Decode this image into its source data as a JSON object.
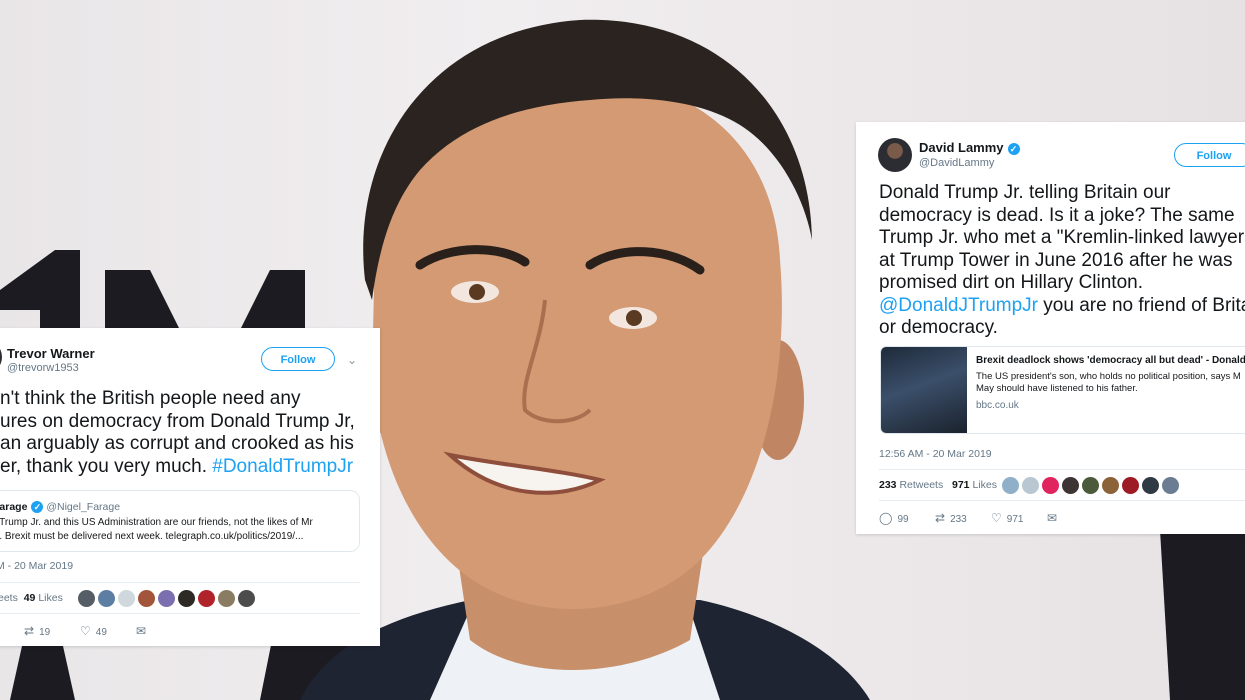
{
  "colors": {
    "accent": "#1da1f2",
    "text_primary": "#14171a",
    "text_secondary": "#657786",
    "heart": "#e0245e"
  },
  "left_tweet": {
    "author_name": "Trevor Warner",
    "author_handle": "@trevorw1953",
    "follow_label": "Follow",
    "text_lines": [
      "n't think the British people need any",
      "ures on democracy from Donald Trump Jr,",
      "an arguably as corrupt and crooked as his",
      "er, thank you very much. "
    ],
    "hashtag": "#DonaldTrumpJr",
    "quote": {
      "author_name": "Farage",
      "author_handle": "@Nigel_Farage",
      "text_lines": [
        "d Trump Jr. and this US Administration are our friends, not the likes of Mr",
        "er. Brexit must be delivered next week. telegraph.co.uk/politics/2019/..."
      ]
    },
    "timestamp": "M - 20 Mar 2019",
    "retweets_label": "eets",
    "likes_count": "49",
    "likes_label": "Likes",
    "retweet_action_count": "19",
    "like_action_count": "49"
  },
  "right_tweet": {
    "author_name": "David Lammy",
    "author_handle": "@DavidLammy",
    "follow_label": "Follow",
    "text_lines": [
      "Donald Trump Jr. telling Britain our",
      "democracy is dead. Is it a joke? The same",
      "Trump Jr. who met a \"Kremlin-linked lawyer",
      "at Trump Tower in June 2016 after he was",
      "promised dirt on Hillary Clinton."
    ],
    "mention": "@DonaldJTrumpJr",
    "text_after_mention": " you are no friend of Brita",
    "text_last_line": "or democracy.",
    "link_card": {
      "title": "Brexit deadlock shows 'democracy all but dead' - Donald T",
      "desc_lines": [
        "The US president's son, who holds no political position, says M",
        "May should have listened to his father."
      ],
      "domain": "bbc.co.uk"
    },
    "timestamp": "12:56 AM - 20 Mar 2019",
    "retweets_count": "233",
    "retweets_label": "Retweets",
    "likes_count": "971",
    "likes_label": "Likes",
    "reply_action_count": "99",
    "retweet_action_count": "233",
    "like_action_count": "971"
  },
  "icons": {
    "verified": "verified-badge-icon",
    "chevron": "chevron-down-icon",
    "reply": "reply-icon",
    "retweet": "retweet-icon",
    "like": "heart-icon",
    "message": "direct-message-icon"
  }
}
